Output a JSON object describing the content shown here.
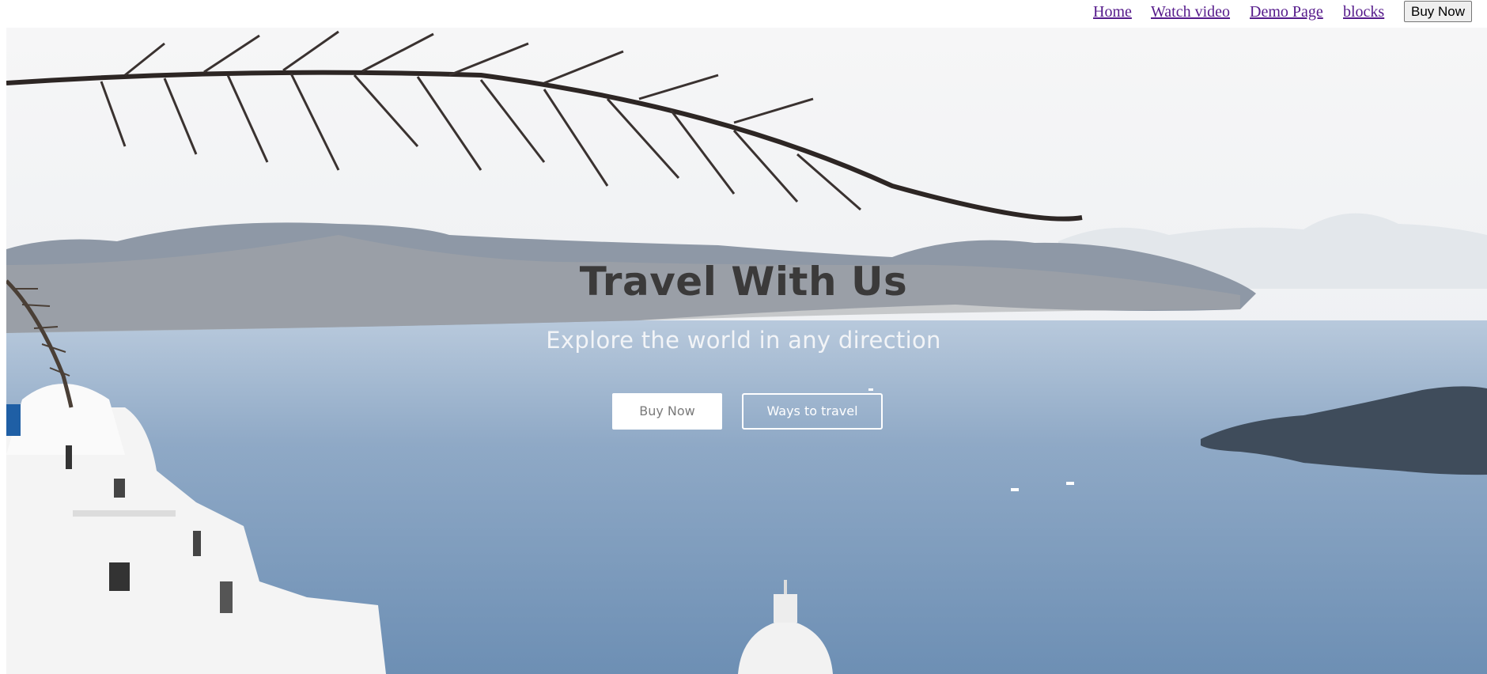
{
  "nav": {
    "links": [
      {
        "label": "Home"
      },
      {
        "label": "Watch video"
      },
      {
        "label": "Demo Page"
      },
      {
        "label": "blocks"
      }
    ],
    "cta_label": "Buy Now"
  },
  "hero": {
    "title": "Travel With Us",
    "subtitle": "Explore the world in any direction",
    "primary_button": "Buy Now",
    "secondary_button": "Ways to travel",
    "background_image": "santorini-sea-view"
  },
  "colors": {
    "link": "#551a8b",
    "title": "#3b3a3a",
    "subtitle": "#f2f4f7",
    "sea": "#7f9fc0",
    "sky": "#f3f4f5"
  }
}
